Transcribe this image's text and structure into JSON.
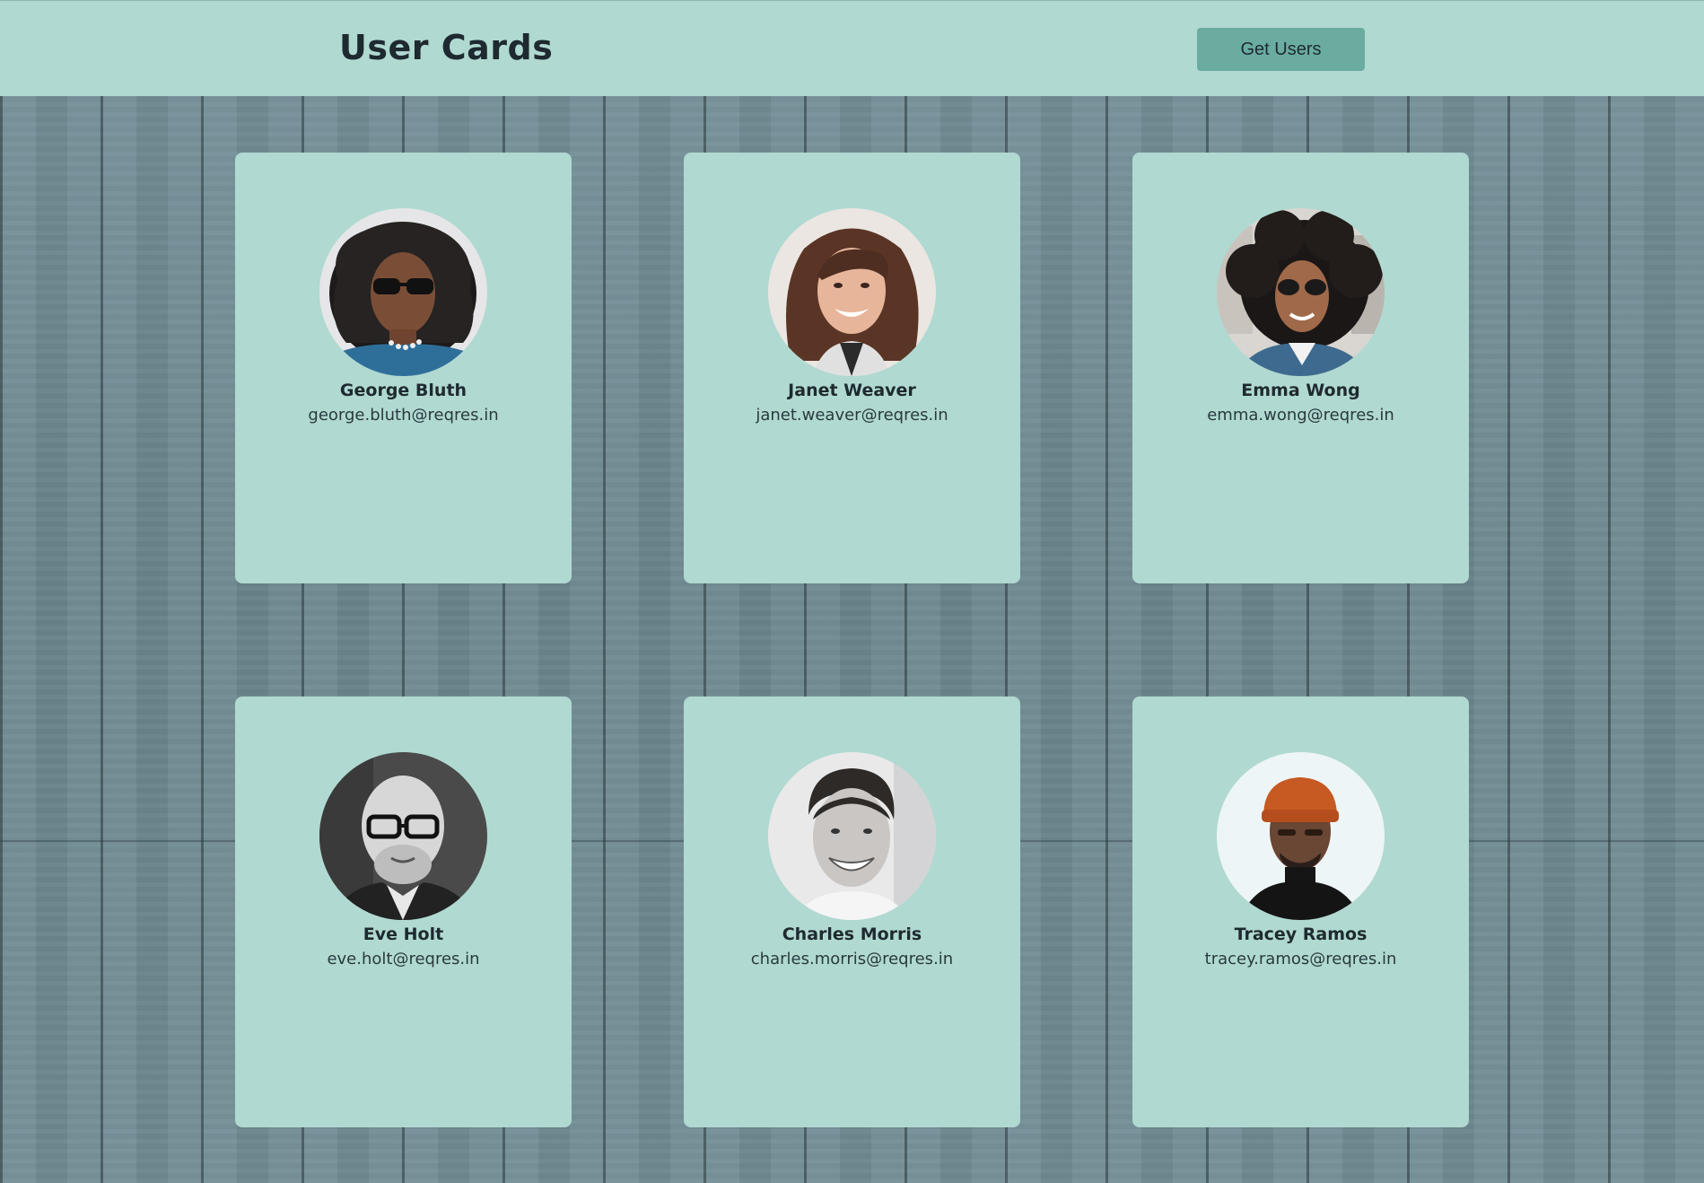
{
  "header": {
    "title": "User Cards",
    "button_label": "Get Users"
  },
  "colors": {
    "card_background": "#b0d9d1",
    "button_background": "#6aaca0",
    "page_background": "#6f8a90",
    "text": "#1e2a30"
  },
  "users": [
    {
      "name": "George Bluth",
      "email": "george.bluth@reqres.in",
      "avatar_icon": "avatar-photo"
    },
    {
      "name": "Janet Weaver",
      "email": "janet.weaver@reqres.in",
      "avatar_icon": "avatar-photo"
    },
    {
      "name": "Emma Wong",
      "email": "emma.wong@reqres.in",
      "avatar_icon": "avatar-photo"
    },
    {
      "name": "Eve Holt",
      "email": "eve.holt@reqres.in",
      "avatar_icon": "avatar-photo"
    },
    {
      "name": "Charles Morris",
      "email": "charles.morris@reqres.in",
      "avatar_icon": "avatar-photo"
    },
    {
      "name": "Tracey Ramos",
      "email": "tracey.ramos@reqres.in",
      "avatar_icon": "avatar-photo"
    }
  ]
}
